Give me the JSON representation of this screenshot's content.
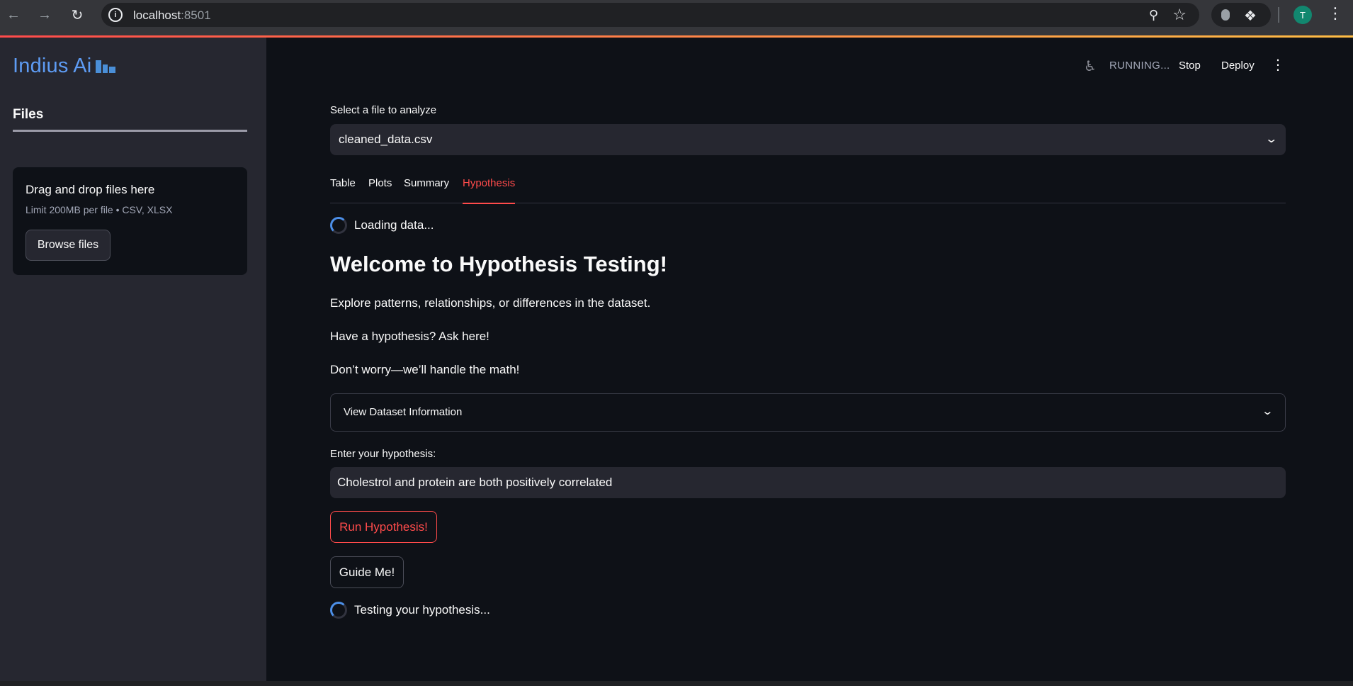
{
  "browser": {
    "url_host": "localhost",
    "url_port": ":8501",
    "profile_initial": "T"
  },
  "sidebar": {
    "logo": "Indius Ai",
    "files_title": "Files",
    "uploader": {
      "drag_text": "Drag and drop files here",
      "limit_text": "Limit 200MB per file • CSV, XLSX",
      "browse_label": "Browse files"
    }
  },
  "topbar": {
    "status": "RUNNING...",
    "stop_label": "Stop",
    "deploy_label": "Deploy"
  },
  "main": {
    "select_label": "Select a file to analyze",
    "selected_file": "cleaned_data.csv",
    "tabs": [
      {
        "label": "Table"
      },
      {
        "label": "Plots"
      },
      {
        "label": "Summary"
      },
      {
        "label": "Hypothesis"
      }
    ],
    "active_tab": "Hypothesis",
    "loading_text": "Loading data...",
    "heading": "Welcome to Hypothesis Testing!",
    "paragraphs": [
      "Explore patterns, relationships, or differences in the dataset.",
      "Have a hypothesis? Ask here!",
      "Don’t worry—we’ll handle the math!"
    ],
    "expander_label": "View Dataset Information",
    "hypothesis_label": "Enter your hypothesis:",
    "hypothesis_value": "Cholestrol and protein are both positively correlated",
    "run_button": "Run Hypothesis!",
    "guide_button": "Guide Me!",
    "testing_text": "Testing your hypothesis..."
  },
  "colors": {
    "accent": "#ff4b4b",
    "logo": "#5e9cf4",
    "spinner": "#4c8fe8",
    "sidebar_bg": "#262730",
    "main_bg": "#0e1117"
  }
}
